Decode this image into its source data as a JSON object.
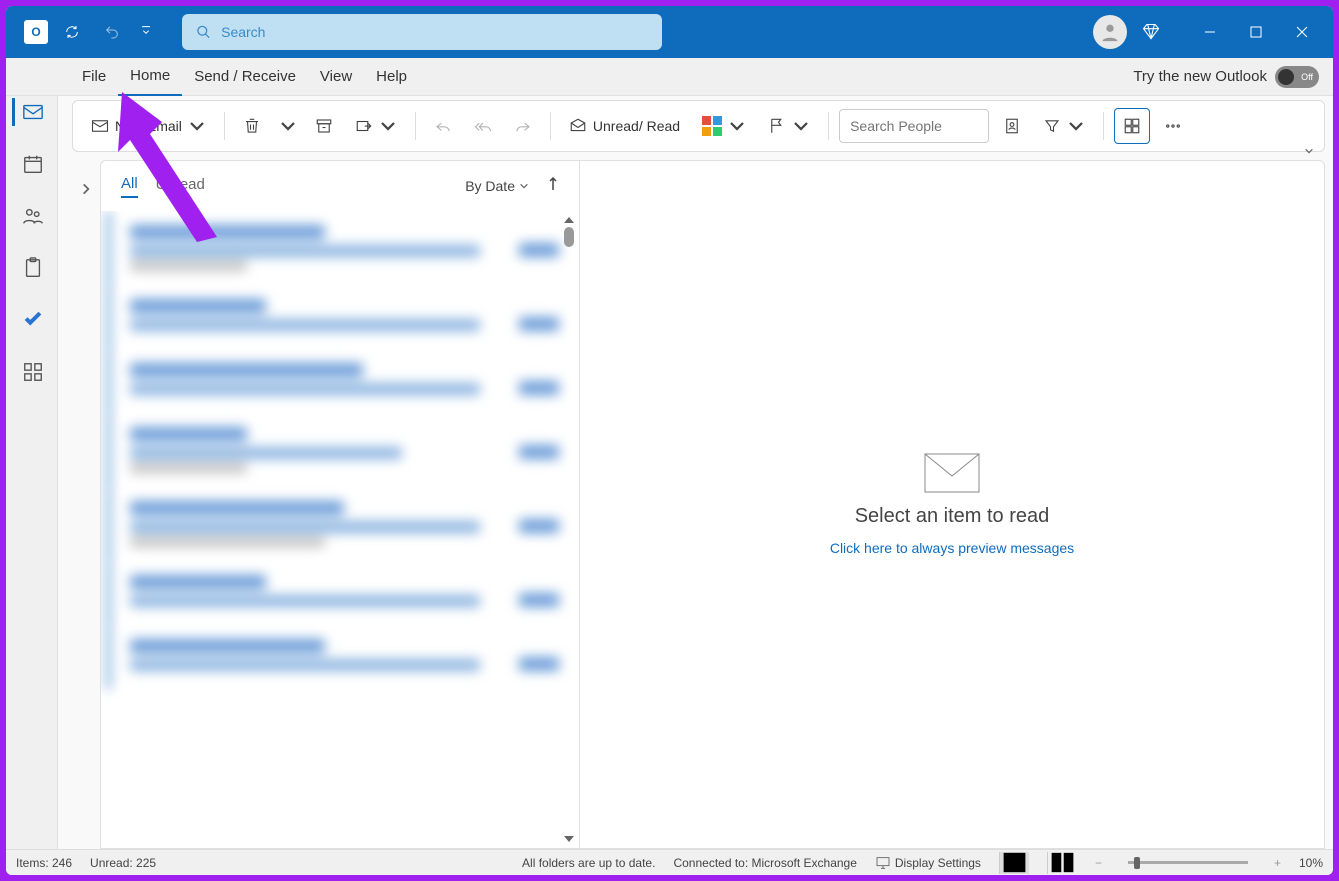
{
  "titlebar": {
    "search_placeholder": "Search"
  },
  "menubar": {
    "items": [
      "File",
      "Home",
      "Send / Receive",
      "View",
      "Help"
    ],
    "try_new_label": "Try the new Outlook",
    "toggle_state": "Off"
  },
  "ribbon": {
    "new_email_label": "New Email",
    "unread_read_label": "Unread/ Read",
    "search_people_placeholder": "Search People"
  },
  "message_list": {
    "tabs": {
      "all": "All",
      "unread": "Unread"
    },
    "sort_label": "By Date"
  },
  "reading_pane": {
    "title": "Select an item to read",
    "link": "Click here to always preview messages"
  },
  "statusbar": {
    "items_label": "Items: 246",
    "unread_label": "Unread: 225",
    "folder_status": "All folders are up to date.",
    "connection": "Connected to: Microsoft Exchange",
    "display_settings": "Display Settings",
    "zoom_level": "10%"
  }
}
